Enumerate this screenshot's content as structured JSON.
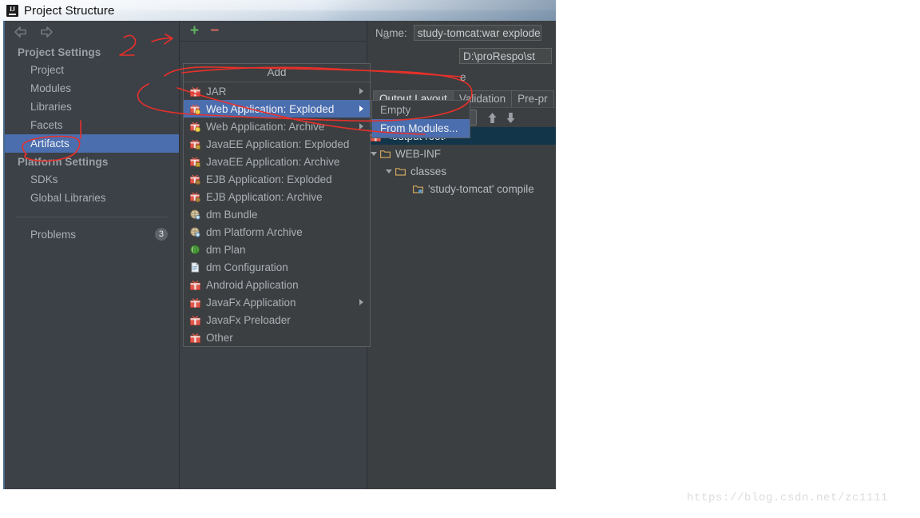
{
  "window": {
    "title": "Project Structure",
    "logo_icon": "intellij-idea-logo-icon"
  },
  "sidebar": {
    "back_icon": "arrow-left-icon",
    "forward_icon": "arrow-right-icon",
    "sections": [
      {
        "heading": "Project Settings",
        "items": [
          {
            "label": "Project",
            "selected": false
          },
          {
            "label": "Modules",
            "selected": false
          },
          {
            "label": "Libraries",
            "selected": false
          },
          {
            "label": "Facets",
            "selected": false
          },
          {
            "label": "Artifacts",
            "selected": true
          }
        ]
      },
      {
        "heading": "Platform Settings",
        "items": [
          {
            "label": "SDKs",
            "selected": false
          },
          {
            "label": "Global Libraries",
            "selected": false
          }
        ]
      }
    ],
    "problems": {
      "label": "Problems",
      "count": "3"
    }
  },
  "artifacts_toolbar": {
    "add_label": "+",
    "remove_label": "−",
    "add_icon": "plus-icon",
    "remove_icon": "minus-icon"
  },
  "add_menu": {
    "title": "Add",
    "items": [
      {
        "label": "JAR",
        "icon": "jar-artifact-icon",
        "submenu": true,
        "selected": false
      },
      {
        "label": "Web Application: Exploded",
        "icon": "web-exploded-artifact-icon",
        "submenu": true,
        "selected": true
      },
      {
        "label": "Web Application: Archive",
        "icon": "web-archive-artifact-icon",
        "submenu": true,
        "selected": false
      },
      {
        "label": "JavaEE Application: Exploded",
        "icon": "javaee-exploded-artifact-icon",
        "submenu": false,
        "selected": false
      },
      {
        "label": "JavaEE Application: Archive",
        "icon": "javaee-archive-artifact-icon",
        "submenu": false,
        "selected": false
      },
      {
        "label": "EJB Application: Exploded",
        "icon": "ejb-exploded-artifact-icon",
        "submenu": false,
        "selected": false
      },
      {
        "label": "EJB Application: Archive",
        "icon": "ejb-archive-artifact-icon",
        "submenu": false,
        "selected": false
      },
      {
        "label": "dm Bundle",
        "icon": "dm-bundle-icon",
        "submenu": false,
        "selected": false
      },
      {
        "label": "dm Platform Archive",
        "icon": "dm-platform-archive-icon",
        "submenu": false,
        "selected": false
      },
      {
        "label": "dm Plan",
        "icon": "dm-plan-icon",
        "submenu": false,
        "selected": false
      },
      {
        "label": "dm Configuration",
        "icon": "dm-configuration-icon",
        "submenu": false,
        "selected": false
      },
      {
        "label": "Android Application",
        "icon": "android-artifact-icon",
        "submenu": false,
        "selected": false
      },
      {
        "label": "JavaFx Application",
        "icon": "javafx-artifact-icon",
        "submenu": true,
        "selected": false
      },
      {
        "label": "JavaFx Preloader",
        "icon": "javafx-preloader-icon",
        "submenu": false,
        "selected": false
      },
      {
        "label": "Other",
        "icon": "other-artifact-icon",
        "submenu": false,
        "selected": false
      }
    ]
  },
  "sub_menu": {
    "items": [
      {
        "label": "Empty",
        "selected": false
      },
      {
        "label": "From Modules...",
        "selected": true
      }
    ]
  },
  "detail": {
    "name_label_pre": "N",
    "name_label_mnemonic": "a",
    "name_label_post": "me:",
    "name_value": "study-tomcat:war exploded",
    "path_value": "D:\\proRespo\\st",
    "cut_text": "e",
    "tabs": [
      {
        "label": "Output Layout",
        "active": true
      },
      {
        "label": "Validation",
        "active": false
      },
      {
        "label": "Pre-pr",
        "active": false
      }
    ],
    "output_toolbar": [
      {
        "icon": "create-directory-icon",
        "label": ""
      },
      {
        "icon": "create-archive-icon",
        "label": ""
      },
      {
        "icon": "add-copy-icon",
        "label": "+"
      },
      {
        "icon": "remove-icon",
        "label": "−"
      },
      {
        "icon": "sort-alphabetically-icon",
        "label": ""
      },
      {
        "icon": "move-up-icon",
        "label": ""
      },
      {
        "icon": "move-down-icon",
        "label": ""
      }
    ],
    "tree": [
      {
        "label": "<output root>",
        "icon": "artifact-root-icon",
        "indent": 0,
        "expander": "none",
        "selected": true
      },
      {
        "label": "WEB-INF",
        "icon": "folder-icon",
        "indent": 1,
        "expander": "expanded",
        "selected": false
      },
      {
        "label": "classes",
        "icon": "folder-icon",
        "indent": 2,
        "expander": "expanded",
        "selected": false
      },
      {
        "label": "'study-tomcat' compile",
        "icon": "module-output-icon",
        "indent": 3,
        "expander": "none",
        "selected": false
      }
    ]
  },
  "annotations": {
    "handwritten_number": "2",
    "color": "#e8302a"
  },
  "watermark": {
    "text": "https://blog.csdn.net/zc1111"
  }
}
